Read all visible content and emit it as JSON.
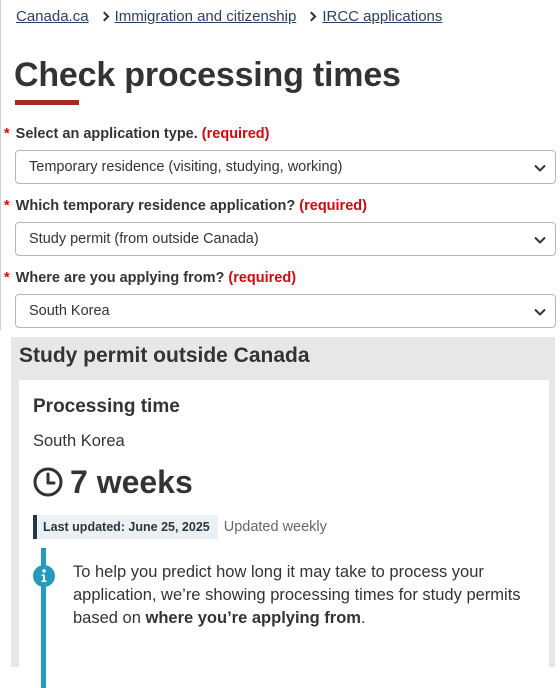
{
  "breadcrumb": [
    {
      "label": "Canada.ca"
    },
    {
      "label": "Immigration and citizenship"
    },
    {
      "label": "IRCC applications"
    }
  ],
  "page_title": "Check processing times",
  "form": {
    "fields": [
      {
        "star": "*",
        "label": "Select an application type.",
        "required": "(required)",
        "value": "Temporary residence (visiting, studying, working)"
      },
      {
        "star": "*",
        "label": "Which temporary residence application?",
        "required": "(required)",
        "value": "Study permit (from outside Canada)"
      },
      {
        "star": "*",
        "label": "Where are you applying from?",
        "required": "(required)",
        "value": "South Korea"
      }
    ]
  },
  "result": {
    "heading": "Study permit outside Canada",
    "card_title": "Processing time",
    "country": "South Korea",
    "duration": "7 weeks",
    "last_updated": "Last updated: June 25, 2025",
    "update_frequency": "Updated weekly",
    "alert": {
      "text_before": "To help you predict how long it may take to process your application, we’re showing processing times for study permits based on ",
      "text_bold": "where you’re applying from",
      "text_after": "."
    }
  },
  "colors": {
    "link": "#284162",
    "required": "#d3080c",
    "title_accent": "#a62a1e",
    "panel_bg": "#e6e7e8",
    "info_blue": "#269abc",
    "badge_border": "#26374a"
  },
  "icons": {
    "breadcrumb_separator": "chevron-right-icon",
    "select_arrow": "chevron-down-icon",
    "clock": "clock-icon",
    "info": "info-icon"
  }
}
